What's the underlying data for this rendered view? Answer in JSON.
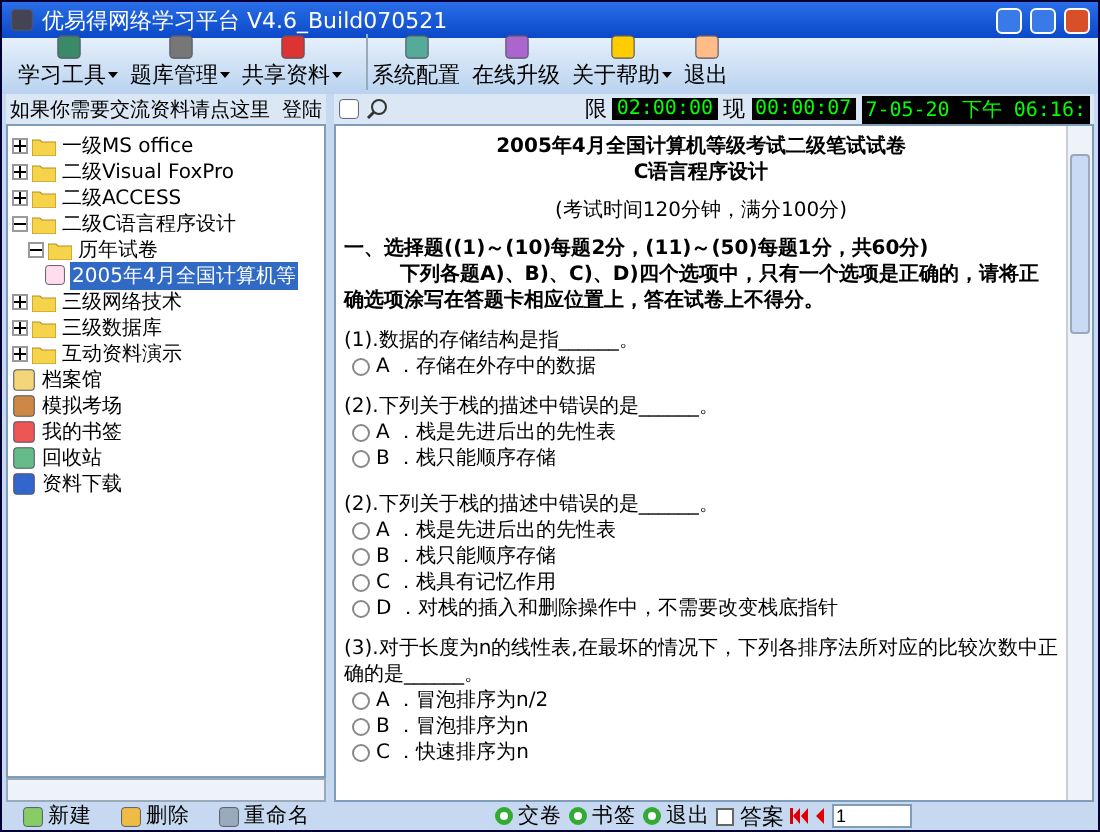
{
  "window": {
    "title": "优易得网络学习平台 V4.6_Build070521"
  },
  "toolbar": [
    {
      "label": "学习工具",
      "has_menu": true
    },
    {
      "label": "题库管理",
      "has_menu": true
    },
    {
      "label": "共享资料",
      "has_menu": true
    },
    {
      "label": "系统配置",
      "has_menu": false,
      "group_start": true
    },
    {
      "label": "在线升级",
      "has_menu": false
    },
    {
      "label": "关于帮助",
      "has_menu": true
    },
    {
      "label": "退出",
      "has_menu": false
    }
  ],
  "sidebar": {
    "notice": "如果你需要交流资料请点这里",
    "login": "登陆",
    "tree": [
      {
        "label": "一级MS office",
        "expanded": false,
        "selected": false
      },
      {
        "label": "二级Visual FoxPro",
        "expanded": false,
        "selected": false
      },
      {
        "label": "二级ACCESS",
        "expanded": false,
        "selected": false
      },
      {
        "label": "二级C语言程序设计",
        "expanded": true,
        "selected": false,
        "children": [
          {
            "label": "历年试卷",
            "expanded": true,
            "selected": false,
            "children": [
              {
                "label": "2005年4月全国计算机等",
                "kind": "doc",
                "selected": true
              }
            ]
          }
        ]
      },
      {
        "label": "三级网络技术",
        "expanded": false,
        "selected": false
      },
      {
        "label": "三级数据库",
        "expanded": false,
        "selected": false
      },
      {
        "label": "互动资料演示",
        "expanded": false,
        "selected": false
      }
    ],
    "links": [
      {
        "label": "档案馆",
        "selected": false
      },
      {
        "label": "模拟考场",
        "selected": false
      },
      {
        "label": "我的书签",
        "selected": false
      },
      {
        "label": "回收站",
        "selected": false
      },
      {
        "label": "资料下载",
        "selected": false
      }
    ],
    "actions": [
      "新建",
      "删除",
      "重命名"
    ]
  },
  "timer": {
    "limit_label": "限",
    "limit": "02:00:00",
    "elapsed_label": "现",
    "elapsed": "00:00:07",
    "clock": "7-05-20 下午 06:16:"
  },
  "document": {
    "title": "2005年4月全国计算机等级考试二级笔试试卷",
    "subtitle": "C语言程序设计",
    "info": "(考试时间120分钟，满分100分)",
    "section": "一、选择题((1)～(10)每题2分，(11)～(50)每题1分，共60分)",
    "instructions": "下列各题A)、B)、C)、D)四个选项中，只有一个选项是正确的，请将正确选项涂写在答题卡相应位置上，答在试卷上不得分。",
    "questions": [
      {
        "text": "(1).数据的存储结构是指______。",
        "options": [
          {
            "label": "A ．存储在外存中的数据",
            "selected": false
          }
        ]
      },
      {
        "text": "(2).下列关于栈的描述中错误的是______。",
        "options": [
          {
            "label": "A ．栈是先进后出的先性表",
            "selected": false
          },
          {
            "label": "B ．栈只能顺序存储",
            "selected": false
          }
        ]
      },
      {
        "text": "(2).下列关于栈的描述中错误的是______。",
        "options": [
          {
            "label": "A ．栈是先进后出的先性表",
            "selected": false
          },
          {
            "label": "B ．栈只能顺序存储",
            "selected": false
          },
          {
            "label": "C ．栈具有记忆作用",
            "selected": false
          },
          {
            "label": "D ．对栈的插入和删除操作中，不需要改变栈底指针",
            "selected": false
          }
        ]
      },
      {
        "text": "(3).对于长度为n的线性表,在最坏的情况下，下列各排序法所对应的比较次数中正确的是______。",
        "options": [
          {
            "label": "A ．冒泡排序为n/2",
            "selected": false
          },
          {
            "label": "B ．冒泡排序为n",
            "selected": false
          },
          {
            "label": "C ．快速排序为n",
            "selected": false
          }
        ]
      }
    ]
  },
  "bottom_bar": {
    "buttons": [
      "交卷",
      "书签",
      "退出"
    ],
    "answer_label": "答案",
    "answer_checked": false,
    "page": "1"
  }
}
